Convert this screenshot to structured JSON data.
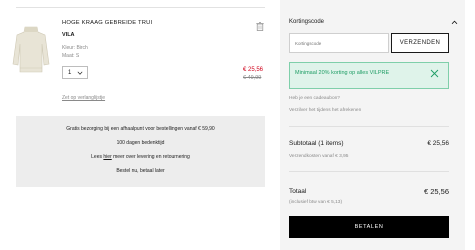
{
  "product": {
    "title": "HOGE KRAAG GEBREIDE TRUI",
    "brand": "VILA",
    "color": "Kleur: Birch",
    "size": "Maat: S",
    "quantity": "1",
    "price_new": "€ 25,56",
    "price_old": "€ 49,99",
    "wishlist_label": "Zet op verlanglijstje"
  },
  "info": {
    "line1": "Gratis bezorging bij een afhaalpunt voor bestellingen vanaf € 59,90",
    "line2": "100 dagen bedenktijd",
    "line3_pre": "Lees ",
    "line3_link": "hier",
    "line3_post": " meer over levering en retournering",
    "line4": "Bestel nu, betaal later"
  },
  "summary": {
    "discount_title": "Kortingscode",
    "discount_placeholder": "Kortingscode",
    "discount_button": "VERZENDEN",
    "alert_text": "Minimaal 20% korting op alles VILPRE",
    "gift_question": "Heb je een cadeaubon?",
    "gift_note": "Verzilver het tijdens het afrekenen",
    "subtotal_label": "Subtotaal (1 items)",
    "subtotal_value": "€ 25,56",
    "shipping_note": "Verzendkosten vanaf € 3,95",
    "total_label": "Totaal",
    "total_value": "€ 25,56",
    "vat_note": "(inclusief btw van € 5,13)",
    "pay_button": "BETALEN"
  },
  "colors": {
    "sale_red": "#d0021b",
    "alert_green": "#1f9d65",
    "alert_bg": "#dff3ea",
    "info_bg": "#ededed",
    "panel_bg": "#f4f4f4"
  }
}
